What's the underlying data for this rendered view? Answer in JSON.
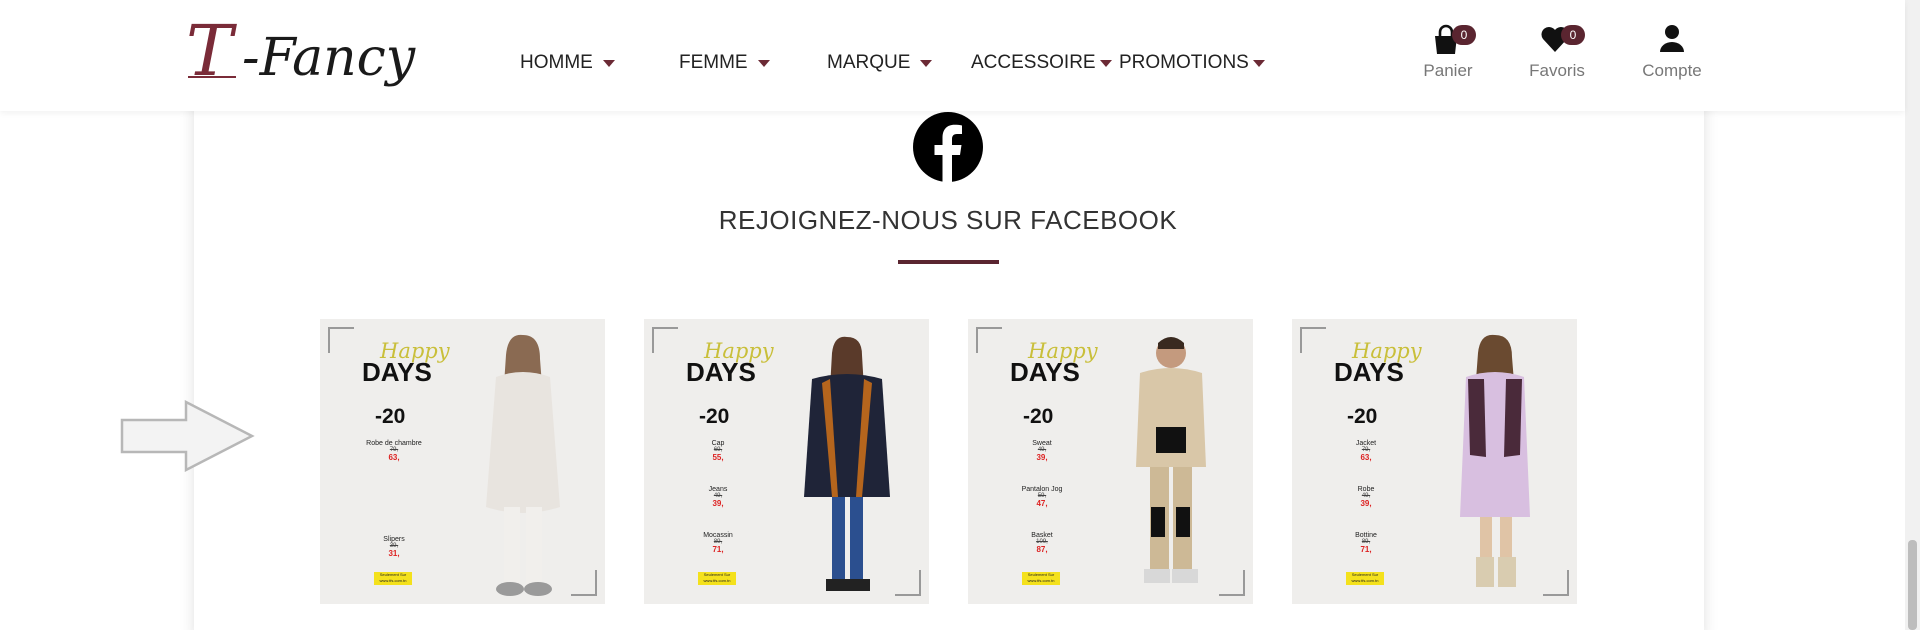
{
  "header": {
    "logo": {
      "first": "T",
      "rest": "-Fancy"
    },
    "nav": [
      {
        "label": "HOMME"
      },
      {
        "label": "FEMME"
      },
      {
        "label": "MARQUE"
      },
      {
        "label": "ACCESSOIRE"
      },
      {
        "label": "PROMOTIONS"
      }
    ],
    "cart": {
      "label": "Panier",
      "count": "0",
      "icon": "shopping-bag-icon"
    },
    "favorites": {
      "label": "Favoris",
      "count": "0",
      "icon": "heart-icon"
    },
    "account": {
      "label": "Compte",
      "icon": "user-icon"
    }
  },
  "section": {
    "icon": "facebook-icon",
    "title": "REJOIGNEZ-NOUS SUR FACEBOOK"
  },
  "posts": [
    {
      "happy": "Happy",
      "days": "DAYS",
      "discount": "-20",
      "items": [
        {
          "name": "Robe de chambre",
          "old": "79,",
          "new": "63,"
        },
        {
          "name": "Slipers",
          "old": "39,",
          "new": "31,"
        }
      ],
      "tag": "Seulement Sur www.tfs.com.tn",
      "colors": {
        "top": "#e8e4df",
        "bottom": "#f1efec"
      }
    },
    {
      "happy": "Happy",
      "days": "DAYS",
      "discount": "-20",
      "items": [
        {
          "name": "Cap",
          "old": "69,",
          "new": "55,"
        },
        {
          "name": "Jeans",
          "old": "49,",
          "new": "39,"
        },
        {
          "name": "Mocassin",
          "old": "89,",
          "new": "71,"
        }
      ],
      "tag": "Seulement Sur www.tfs.com.tn",
      "colors": {
        "top": "#1f2438",
        "bottom": "#2b4f8f"
      }
    },
    {
      "happy": "Happy",
      "days": "DAYS",
      "discount": "-20",
      "items": [
        {
          "name": "Sweat",
          "old": "49,",
          "new": "39,"
        },
        {
          "name": "Pantalon Jog",
          "old": "59,",
          "new": "47,"
        },
        {
          "name": "Basket",
          "old": "109,",
          "new": "87,"
        }
      ],
      "tag": "Seulement Sur www.tfs.com.tn",
      "colors": {
        "top": "#d9c7a8",
        "bottom": "#cdb996"
      }
    },
    {
      "happy": "Happy",
      "days": "DAYS",
      "discount": "-20",
      "items": [
        {
          "name": "Jacket",
          "old": "79,",
          "new": "63,"
        },
        {
          "name": "Robe",
          "old": "49,",
          "new": "39,"
        },
        {
          "name": "Bottine",
          "old": "89,",
          "new": "71,"
        }
      ],
      "tag": "Seulement Sur www.tfs.com.tn",
      "colors": {
        "top": "#4a2a3a",
        "bottom": "#d8bfe0"
      }
    }
  ]
}
